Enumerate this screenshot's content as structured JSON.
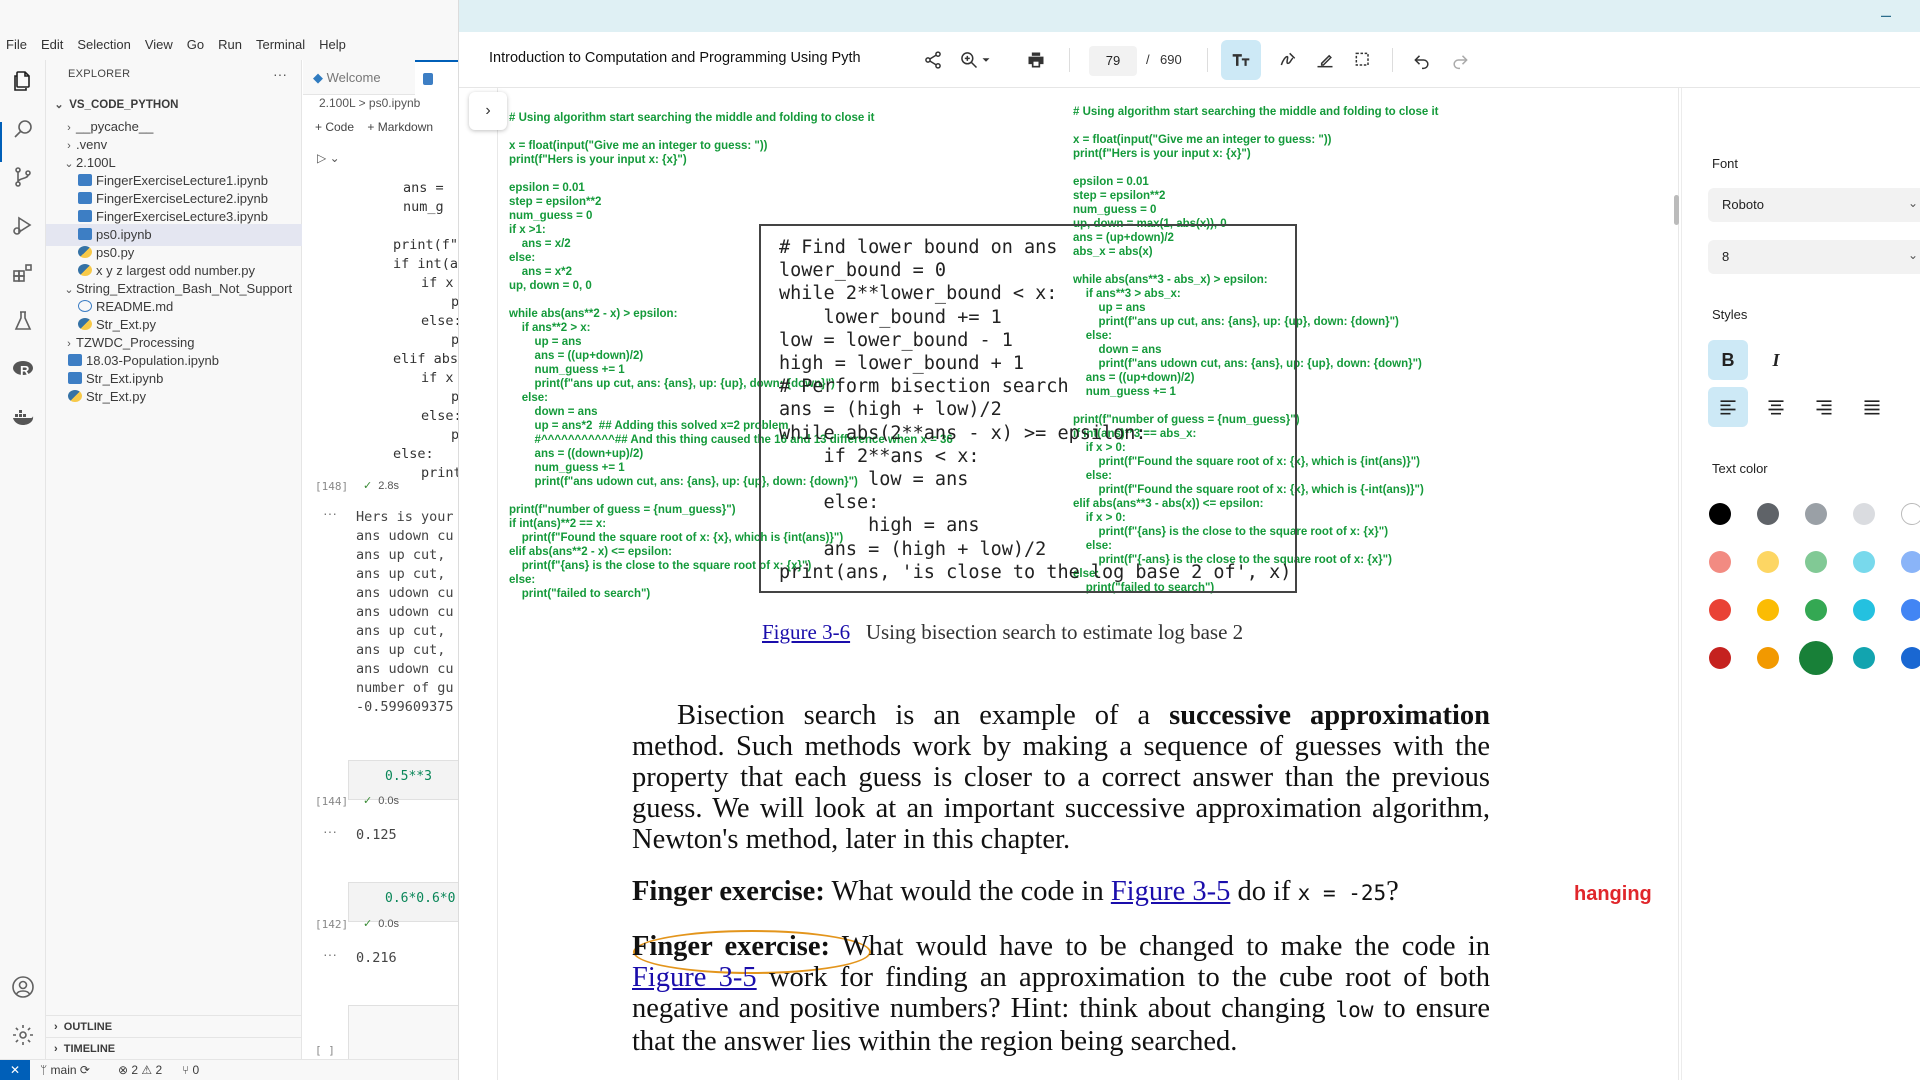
{
  "vscode": {
    "menu": [
      "File",
      "Edit",
      "Selection",
      "View",
      "Go",
      "Run",
      "Terminal",
      "Help"
    ],
    "explorer": {
      "header": "EXPLORER",
      "more": "···",
      "root": "VS_CODE_PYTHON",
      "items": [
        {
          "label": "__pycache__",
          "type": "folder",
          "indent": 1,
          "open": false
        },
        {
          "label": ".venv",
          "type": "folder",
          "indent": 1,
          "open": false
        },
        {
          "label": "2.100L",
          "type": "folder",
          "indent": 1,
          "open": true
        },
        {
          "label": "FingerExerciseLecture1.ipynb",
          "type": "nb",
          "indent": 2
        },
        {
          "label": "FingerExerciseLecture2.ipynb",
          "type": "nb",
          "indent": 2
        },
        {
          "label": "FingerExerciseLecture3.ipynb",
          "type": "nb",
          "indent": 2
        },
        {
          "label": "ps0.ipynb",
          "type": "nb",
          "indent": 2,
          "selected": true
        },
        {
          "label": "ps0.py",
          "type": "py",
          "indent": 2
        },
        {
          "label": "x y z largest odd number.py",
          "type": "py",
          "indent": 2
        },
        {
          "label": "String_Extraction_Bash_Not_Support",
          "type": "folder",
          "indent": 1,
          "open": true
        },
        {
          "label": "README.md",
          "type": "md",
          "indent": 2
        },
        {
          "label": "Str_Ext.py",
          "type": "py",
          "indent": 2
        },
        {
          "label": "TZWDC_Processing",
          "type": "folder",
          "indent": 1,
          "open": false
        },
        {
          "label": "18.03-Population.ipynb",
          "type": "nb",
          "indent": 1
        },
        {
          "label": "Str_Ext.ipynb",
          "type": "nb",
          "indent": 1
        },
        {
          "label": "Str_Ext.py",
          "type": "py",
          "indent": 1
        }
      ],
      "outline": "OUTLINE",
      "timeline": "TIMELINE"
    },
    "editor": {
      "tab_welcome": "Welcome",
      "breadcrumb": "2.100L  >  ps0.ipynb",
      "add_code": "+ Code",
      "add_markdown": "+ Markdown",
      "code_lines": [
        "ans =",
        "num_g",
        "",
        "print(f\"n",
        "if int(an",
        "if x",
        "p",
        "else:",
        "p",
        "elif abs(",
        "if x",
        "p",
        "else:",
        "p",
        "else:",
        "print"
      ],
      "cell1_count": "[148]",
      "cell1_time": "2.8s",
      "cell1_output": [
        "Hers is your",
        "ans udown cu",
        "ans up cut,",
        "ans up cut,",
        "ans udown cu",
        "ans udown cu",
        "ans up cut,",
        "ans up cut,",
        "ans udown cu",
        "number of gu",
        "-0.599609375"
      ],
      "cell2_code": "0.5**3",
      "cell2_count": "[144]",
      "cell2_time": "0.0s",
      "cell2_output": "0.125",
      "cell3_code": "0.6*0.6*0",
      "cell3_count": "[142]",
      "cell3_time": "0.0s",
      "cell3_output": "0.216",
      "cell4_count": "[ ]"
    },
    "status": {
      "branch": "main",
      "problems": "⊗ 2 ⚠ 2",
      "ports": "⑂ 0"
    }
  },
  "viewer": {
    "doc_title": "Introduction to Computation and Programming Using Pyth",
    "page_current": "79",
    "page_sep": "/",
    "page_total": "690",
    "annotation_left": "# Using algorithm start searching the middle and folding to close it\n\nx = float(input(\"Give me an integer to guess: \"))\nprint(f\"Hers is your input x: {x}\")\n\nepsilon = 0.01\nstep = epsilon**2\nnum_guess = 0\nif x >1:\n    ans = x/2\nelse:\n    ans = x*2\nup, down = 0, 0\n\nwhile abs(ans**2 - x) > epsilon:\n    if ans**2 > x:\n        up = ans\n        ans = ((up+down)/2)\n        num_guess += 1\n        print(f\"ans up cut, ans: {ans}, up: {up}, down: {down}\")\n    else:\n        down = ans\n        up = ans*2  ## Adding this solved x=2 problem\n        #^^^^^^^^^^^## And this thing caused the 16 and 13 difference when x = 36\n        ans = ((down+up)/2)\n        num_guess += 1\n        print(f\"ans udown cut, ans: {ans}, up: {up}, down: {down}\")\n\nprint(f\"number of guess = {num_guess}\")\nif int(ans)**2 == x:\n    print(f\"Found the square root of x: {x}, which is {int(ans)}\")\nelif abs(ans**2 - x) <= epsilon:\n    print(f\"{ans} is the close to the square root of x: {x}\")\nelse:\n    print(\"failed to search\")",
    "annotation_right": "# Using algorithm start searching the middle and folding to close it\n\nx = float(input(\"Give me an integer to guess: \"))\nprint(f\"Hers is your input x: {x}\")\n\nepsilon = 0.01\nstep = epsilon**2\nnum_guess = 0\nup, down = max(1, abs(x)), 0\nans = (up+down)/2\nabs_x = abs(x)\n\nwhile abs(ans**3 - abs_x) > epsilon:\n    if ans**3 > abs_x:\n        up = ans\n        print(f\"ans up cut, ans: {ans}, up: {up}, down: {down}\")\n    else:\n        down = ans\n        print(f\"ans udown cut, ans: {ans}, up: {up}, down: {down}\")\n    ans = ((up+down)/2)\n    num_guess += 1\n\nprint(f\"number of guess = {num_guess}\")\nif int(ans)**3 == abs_x:\n    if x > 0:\n        print(f\"Found the square root of x: {x}, which is {int(ans)}\")\n    else:\n        print(f\"Found the square root of x: {x}, which is {-int(ans)}\")\nelif abs(ans**3 - abs(x)) <= epsilon:\n    if x > 0:\n        print(f\"{ans} is the close to the square root of x: {x}\")\n    else:\n        print(f\"{-ans} is the close to the square root of x: {x}\")\nelse:\n    print(\"failed to search\")",
    "figure_code": "# Find lower bound on ans\nlower_bound = 0\nwhile 2**lower_bound < x:\n    lower_bound += 1\nlow = lower_bound - 1\nhigh = lower_bound + 1\n# Perform bisection search\nans = (high + low)/2\nwhile abs(2**ans - x) >= epsilon:\n    if 2**ans < x:\n        low = ans\n    else:\n        high = ans\n    ans = (high + low)/2\nprint(ans, 'is close to the log base 2 of', x)",
    "figure_link": "Figure 3-6",
    "figure_caption": "Using bisection search to estimate log base 2",
    "para1_a": "Bisection search is an example of a ",
    "para1_bold": "successive approximation",
    "para1_b": " method. Such methods work by making a sequence of guesses with the property that each guess is closer to a correct answer than the previous guess. We will look at an important successive approximation algorithm, Newton's method, later in this chapter.",
    "fe1_bold": "Finger exercise:",
    "fe1_a": " What would the code in ",
    "fe1_link": "Figure 3-5",
    "fe1_b": " do if ",
    "fe1_code": "x = -25",
    "fe1_c": "?",
    "hanging_note": "hanging",
    "fe2_bold": "Finger exercise:",
    "fe2_a": " What would have to be changed to make the code in ",
    "fe2_link": "Figure 3-5",
    "fe2_b": " work for finding an approximation to the cube root of both negative and positive numbers? Hint: think about changing ",
    "fe2_code": "low",
    "fe2_c": " to ensure that the answer lies within the region being searched.",
    "panel": {
      "font_label": "Font",
      "font_value": "Roboto",
      "size_value": "8",
      "styles_label": "Styles",
      "bold": "B",
      "italic": "I",
      "text_color_label": "Text color",
      "colors": [
        "#000000",
        "#5f6368",
        "#9aa0a6",
        "#dadce0",
        "#ffffff",
        "#f28b82",
        "#fdd663",
        "#81c995",
        "#78d9ec",
        "#8ab4f8",
        "#e94235",
        "#fbbc04",
        "#34a853",
        "#24c1e0",
        "#4285f4",
        "#c5221f",
        "#f29900",
        "#188038",
        "#12a4af",
        "#1967d2"
      ],
      "selected_color": "#188038"
    }
  }
}
